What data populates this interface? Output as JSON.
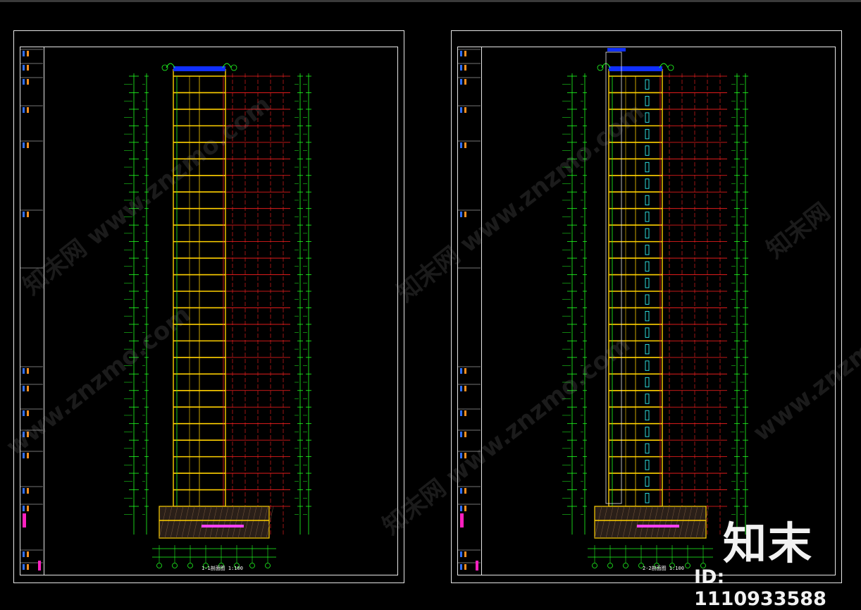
{
  "sheets": [
    {
      "drawing_title": "1-1剖面图",
      "scale": "1:100"
    },
    {
      "drawing_title": "2-2剖面图",
      "scale": "1:100"
    }
  ],
  "watermark": {
    "text_url": "www.znzmo.com",
    "text_cn": "知末网"
  },
  "logo": {
    "brand": "知末",
    "id_label": "ID: 1110933588"
  },
  "colors": {
    "background": "#000000",
    "floor_grid": "#ff2020",
    "structure": "#ffd000",
    "dimension": "#20ff20",
    "roof": "#1030ff",
    "frame": "#e6e6e6"
  }
}
